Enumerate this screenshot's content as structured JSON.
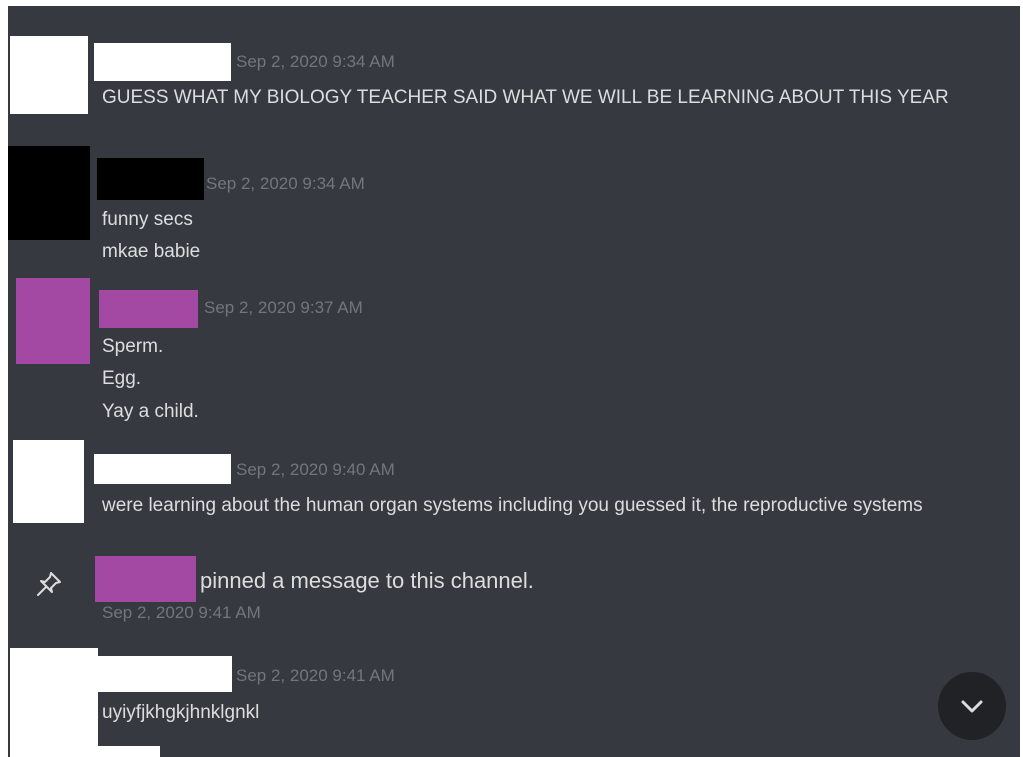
{
  "colors": {
    "chat_bg": "#36393f",
    "text": "#dcddde",
    "timestamp": "#72767d",
    "redact_white": "#ffffff",
    "redact_black": "#000000",
    "redact_purple": "#a349a4",
    "jump_button_bg": "#202225"
  },
  "messages": [
    {
      "timestamp": "Sep 2, 2020 9:34 AM",
      "lines": [
        "GUESS WHAT MY BIOLOGY TEACHER SAID WHAT WE WILL BE LEARNING ABOUT THIS YEAR"
      ]
    },
    {
      "timestamp": "Sep 2, 2020 9:34 AM",
      "lines": [
        "funny secs",
        "mkae babie"
      ]
    },
    {
      "timestamp": "Sep 2, 2020 9:37 AM",
      "lines": [
        "Sperm.",
        "Egg.",
        "Yay a child."
      ]
    },
    {
      "timestamp": "Sep 2, 2020 9:40 AM",
      "lines": [
        "were learning about the human organ systems including you guessed it, the reproductive systems"
      ]
    },
    {
      "timestamp": "Sep 2, 2020 9:41 AM",
      "lines": [
        "uyiyfjkhgkjhnklgnkl"
      ]
    }
  ],
  "system_message": {
    "icon": "pin-icon",
    "text": "pinned a message to this channel.",
    "timestamp": "Sep 2, 2020 9:41 AM"
  },
  "jump_button": {
    "icon": "chevron-down-icon"
  }
}
